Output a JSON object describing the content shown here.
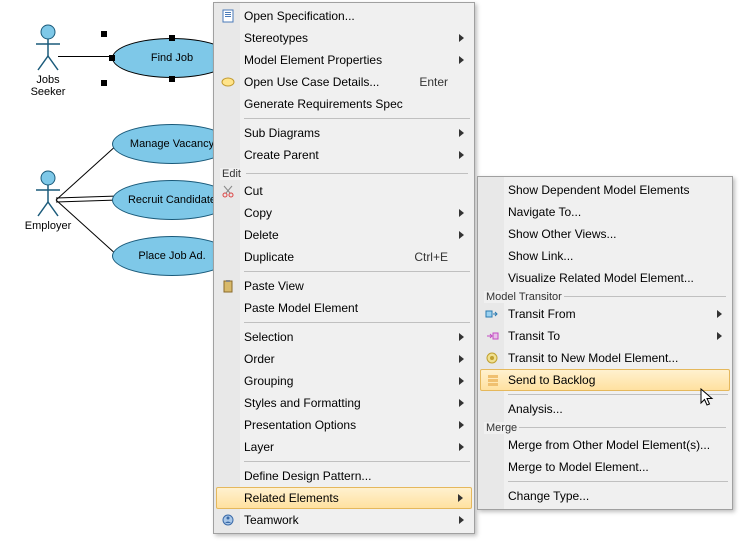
{
  "actors": {
    "seeker": "Jobs Seeker",
    "employer": "Employer"
  },
  "usecases": {
    "find_job": "Find Job",
    "manage_vacancy": "Manage Vacancy",
    "recruit_candidate": "Recruit Candidate",
    "place_job_ad": "Place Job Ad."
  },
  "menu1": {
    "open_spec": "Open Specification...",
    "stereotypes": "Stereotypes",
    "model_elem_props": "Model Element Properties",
    "open_use_case": "Open Use Case Details...",
    "open_use_case_key": "Enter",
    "gen_req_spec": "Generate Requirements Spec",
    "sub_diagrams": "Sub Diagrams",
    "create_parent": "Create Parent",
    "edit_group": "Edit",
    "cut": "Cut",
    "copy": "Copy",
    "delete": "Delete",
    "duplicate": "Duplicate",
    "duplicate_key": "Ctrl+E",
    "paste_view": "Paste View",
    "paste_model": "Paste Model Element",
    "selection": "Selection",
    "order": "Order",
    "grouping": "Grouping",
    "styles": "Styles and Formatting",
    "presentation": "Presentation Options",
    "layer": "Layer",
    "define_design": "Define Design Pattern...",
    "related_elements": "Related Elements",
    "teamwork": "Teamwork"
  },
  "menu2": {
    "show_dependent": "Show Dependent Model Elements",
    "navigate_to": "Navigate To...",
    "show_other_views": "Show Other Views...",
    "show_link": "Show Link...",
    "visualize_related": "Visualize Related Model Element...",
    "model_transitor_group": "Model Transitor",
    "transit_from": "Transit From",
    "transit_to": "Transit To",
    "transit_new": "Transit to New Model Element...",
    "send_to_backlog": "Send to Backlog",
    "analysis": "Analysis...",
    "merge_group": "Merge",
    "merge_from_other": "Merge from Other Model Element(s)...",
    "merge_to_model": "Merge to Model Element...",
    "change_type": "Change Type..."
  }
}
